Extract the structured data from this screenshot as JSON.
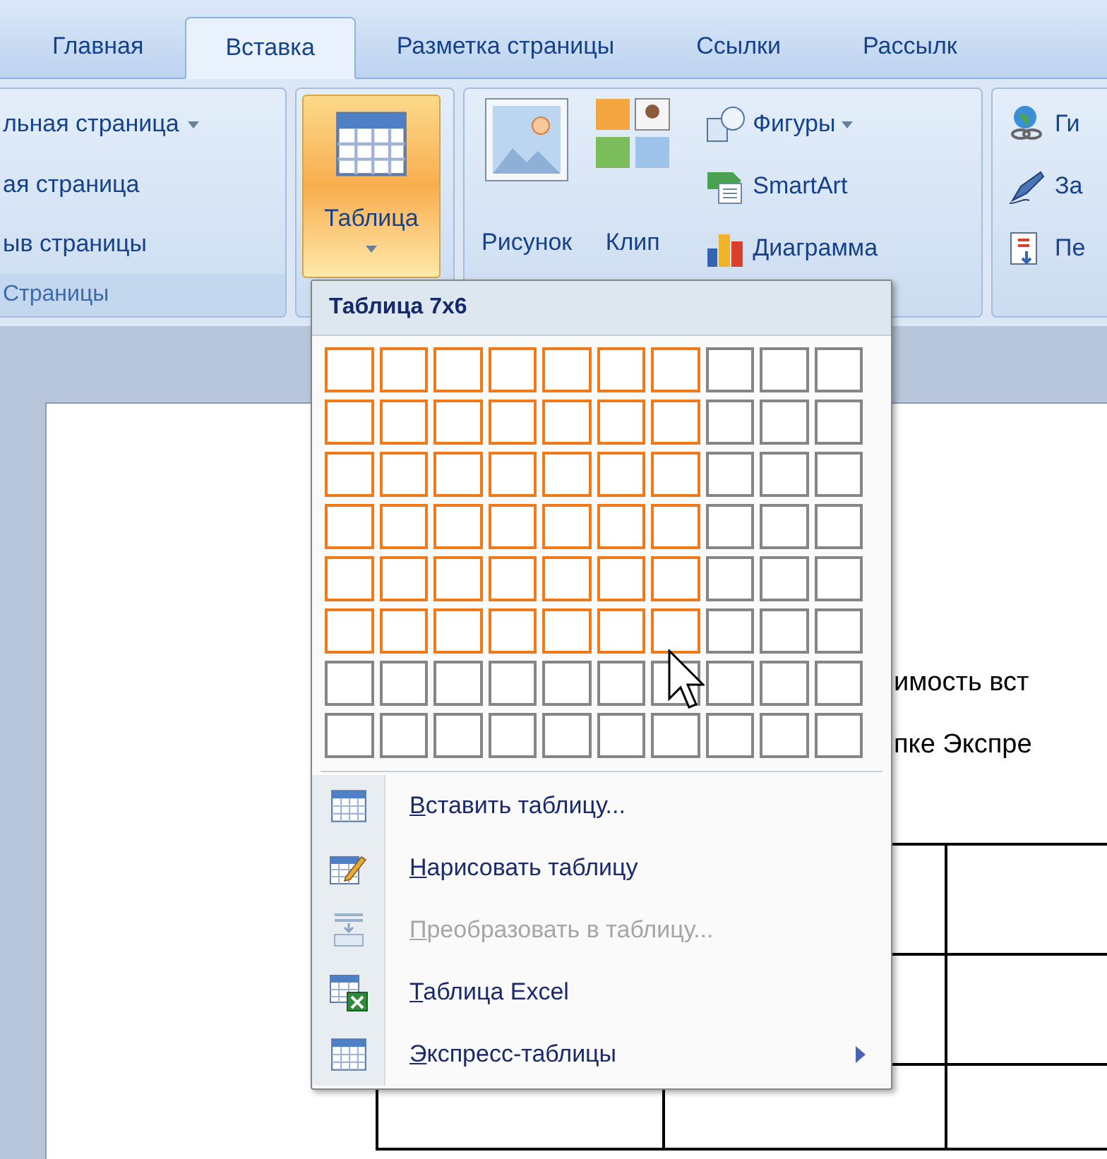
{
  "tabs": [
    {
      "label": "Главная",
      "selected": false
    },
    {
      "label": "Вставка",
      "selected": true
    },
    {
      "label": "Разметка страницы",
      "selected": false
    },
    {
      "label": "Ссылки",
      "selected": false
    },
    {
      "label": "Рассылк",
      "selected": false
    }
  ],
  "ribbon": {
    "pages_group": {
      "label": "Страницы",
      "items": [
        {
          "label": "льная страница",
          "dropdown": true
        },
        {
          "label": "ая страница",
          "dropdown": false
        },
        {
          "label": "ыв страницы",
          "dropdown": false
        }
      ]
    },
    "table_button": {
      "label": "Таблица",
      "expanded": true
    },
    "illustrations": {
      "large": [
        {
          "label": "Рисунок"
        },
        {
          "label": "Клип"
        }
      ],
      "small": [
        {
          "label": "Фигуры",
          "dropdown": true
        },
        {
          "label": "SmartArt",
          "dropdown": false
        },
        {
          "label": "Диаграмма",
          "dropdown": false
        }
      ]
    },
    "links_group": {
      "items": [
        {
          "label": "Ги"
        },
        {
          "label": "За"
        },
        {
          "label": "Пе"
        }
      ]
    }
  },
  "dropdown": {
    "title": "Таблица 7x6",
    "grid": [
      {
        "cells": [
          {
            "selected": true
          },
          {
            "selected": true
          },
          {
            "selected": true
          },
          {
            "selected": true
          },
          {
            "selected": true
          },
          {
            "selected": true
          },
          {
            "selected": true
          },
          {
            "selected": false
          },
          {
            "selected": false
          },
          {
            "selected": false
          }
        ]
      },
      {
        "cells": [
          {
            "selected": true
          },
          {
            "selected": true
          },
          {
            "selected": true
          },
          {
            "selected": true
          },
          {
            "selected": true
          },
          {
            "selected": true
          },
          {
            "selected": true
          },
          {
            "selected": false
          },
          {
            "selected": false
          },
          {
            "selected": false
          }
        ]
      },
      {
        "cells": [
          {
            "selected": true
          },
          {
            "selected": true
          },
          {
            "selected": true
          },
          {
            "selected": true
          },
          {
            "selected": true
          },
          {
            "selected": true
          },
          {
            "selected": true
          },
          {
            "selected": false
          },
          {
            "selected": false
          },
          {
            "selected": false
          }
        ]
      },
      {
        "cells": [
          {
            "selected": true
          },
          {
            "selected": true
          },
          {
            "selected": true
          },
          {
            "selected": true
          },
          {
            "selected": true
          },
          {
            "selected": true
          },
          {
            "selected": true
          },
          {
            "selected": false
          },
          {
            "selected": false
          },
          {
            "selected": false
          }
        ]
      },
      {
        "cells": [
          {
            "selected": true
          },
          {
            "selected": true
          },
          {
            "selected": true
          },
          {
            "selected": true
          },
          {
            "selected": true
          },
          {
            "selected": true
          },
          {
            "selected": true
          },
          {
            "selected": false
          },
          {
            "selected": false
          },
          {
            "selected": false
          }
        ]
      },
      {
        "cells": [
          {
            "selected": true
          },
          {
            "selected": true
          },
          {
            "selected": true
          },
          {
            "selected": true
          },
          {
            "selected": true
          },
          {
            "selected": true
          },
          {
            "selected": true
          },
          {
            "selected": false
          },
          {
            "selected": false
          },
          {
            "selected": false
          }
        ]
      },
      {
        "cells": [
          {
            "selected": false
          },
          {
            "selected": false
          },
          {
            "selected": false
          },
          {
            "selected": false
          },
          {
            "selected": false
          },
          {
            "selected": false
          },
          {
            "selected": false
          },
          {
            "selected": false
          },
          {
            "selected": false
          },
          {
            "selected": false
          }
        ]
      },
      {
        "cells": [
          {
            "selected": false
          },
          {
            "selected": false
          },
          {
            "selected": false
          },
          {
            "selected": false
          },
          {
            "selected": false
          },
          {
            "selected": false
          },
          {
            "selected": false
          },
          {
            "selected": false
          },
          {
            "selected": false
          },
          {
            "selected": false
          }
        ]
      }
    ],
    "menu": [
      {
        "label": "Вставить таблицу...",
        "disabled": false,
        "submenu": false
      },
      {
        "label": "Нарисовать таблицу",
        "disabled": false,
        "submenu": false
      },
      {
        "label": "Преобразовать в таблицу...",
        "disabled": true,
        "submenu": false
      },
      {
        "label": "Таблица Excel",
        "disabled": false,
        "submenu": false
      },
      {
        "label": "Экспресс-таблицы",
        "disabled": false,
        "submenu": true
      }
    ]
  },
  "document": {
    "lines": [
      "имость вст",
      "пке Экспре"
    ]
  }
}
